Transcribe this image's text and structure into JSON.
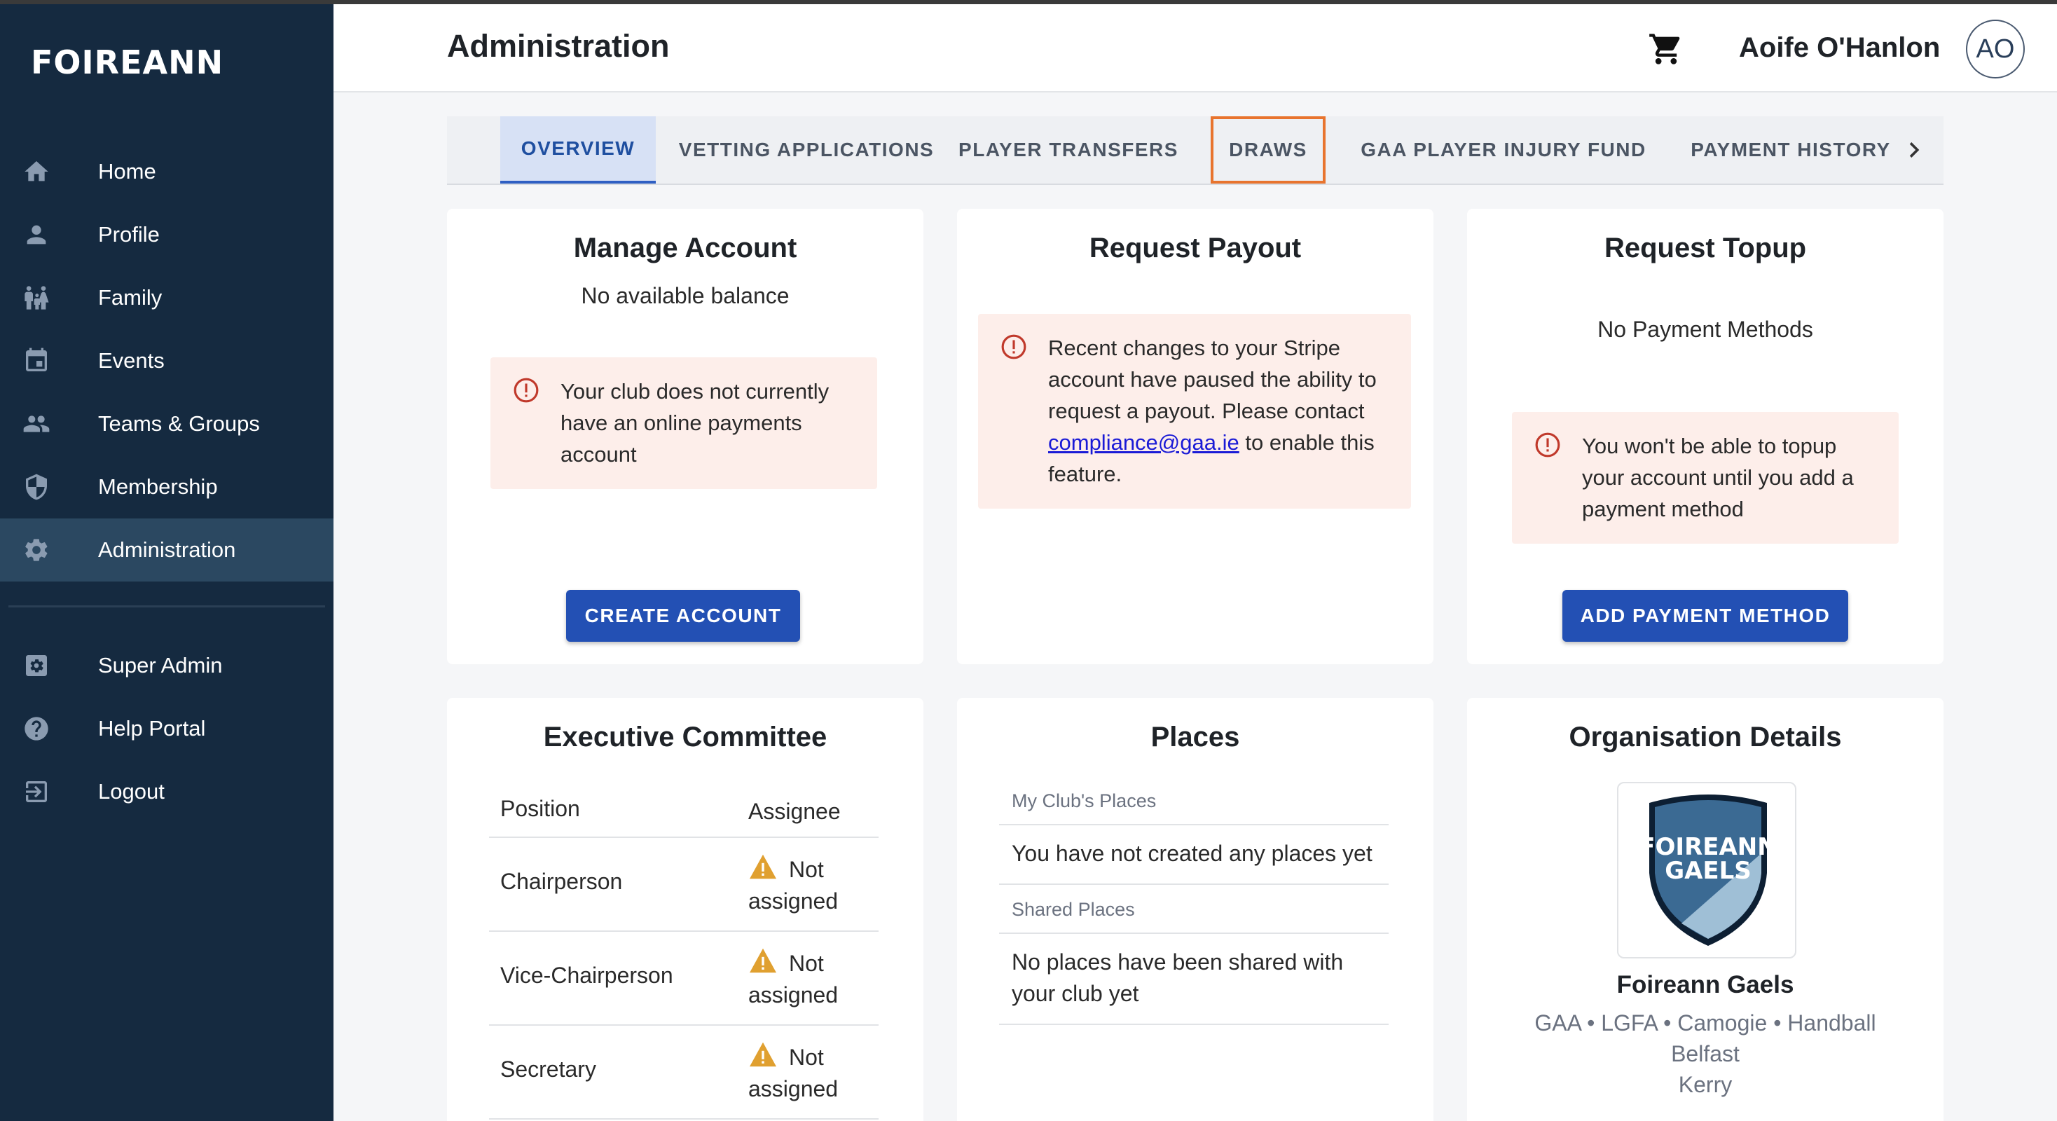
{
  "brand": {
    "logo_text": "FOIREANN"
  },
  "sidebar": {
    "items": [
      {
        "label": "Home",
        "icon": "home-icon"
      },
      {
        "label": "Profile",
        "icon": "person-icon"
      },
      {
        "label": "Family",
        "icon": "family-icon"
      },
      {
        "label": "Events",
        "icon": "calendar-icon"
      },
      {
        "label": "Teams & Groups",
        "icon": "group-icon"
      },
      {
        "label": "Membership",
        "icon": "shield-icon"
      },
      {
        "label": "Administration",
        "icon": "gear-icon",
        "active": true
      }
    ],
    "bottom_items": [
      {
        "label": "Super Admin",
        "icon": "admin-settings-icon"
      },
      {
        "label": "Help Portal",
        "icon": "help-icon"
      },
      {
        "label": "Logout",
        "icon": "logout-icon"
      }
    ]
  },
  "header": {
    "title": "Administration",
    "user_name": "Aoife O'Hanlon",
    "avatar_initials": "AO"
  },
  "tabs": [
    {
      "label": "OVERVIEW",
      "active": true
    },
    {
      "label": "VETTING APPLICATIONS"
    },
    {
      "label": "PLAYER TRANSFERS"
    },
    {
      "label": "DRAWS",
      "outlined": true
    },
    {
      "label": "GAA PLAYER INJURY FUND"
    },
    {
      "label": "PAYMENT HISTORY"
    }
  ],
  "manage_account": {
    "title": "Manage Account",
    "balance_text": "No available balance",
    "alert_text": "Your club does not currently have an online payments account",
    "button_label": "CREATE ACCOUNT"
  },
  "request_payout": {
    "title": "Request Payout",
    "alert_before": "Recent changes to your Stripe account have paused the ability to request a payout. Please contact ",
    "alert_link": "compliance@gaa.ie",
    "alert_after": " to enable this feature."
  },
  "request_topup": {
    "title": "Request Topup",
    "methods_text": "No Payment Methods",
    "alert_text": "You won't be able to topup your account until you add a payment method",
    "button_label": "ADD PAYMENT METHOD"
  },
  "executive_committee": {
    "title": "Executive Committee",
    "headers": {
      "position": "Position",
      "assignee": "Assignee"
    },
    "rows": [
      {
        "position": "Chairperson",
        "status_line1": "Not",
        "status_line2": "assigned"
      },
      {
        "position": "Vice-Chairperson",
        "status_line1": "Not",
        "status_line2": "assigned"
      },
      {
        "position": "Secretary",
        "status_line1": "Not",
        "status_line2": "assigned"
      }
    ]
  },
  "places": {
    "title": "Places",
    "my_club_header": "My Club's Places",
    "my_club_empty": "You have not created any places yet",
    "shared_header": "Shared Places",
    "shared_empty": "No places have been shared with your club yet"
  },
  "organisation": {
    "title": "Organisation Details",
    "crest_line1": "FOIREANN",
    "crest_line2": "GAELS",
    "name": "Foireann Gaels",
    "codes": "GAA • LGFA • Camogie • Handball",
    "city": "Belfast",
    "county": "Kerry"
  },
  "colors": {
    "sidebar_bg": "#152a40",
    "sidebar_active": "#2b4861",
    "primary_button": "#2350b4",
    "alert_bg": "#fdeeea",
    "alert_icon": "#c0392b",
    "warning_icon": "#e0a030",
    "tab_outline": "#e8742e"
  }
}
